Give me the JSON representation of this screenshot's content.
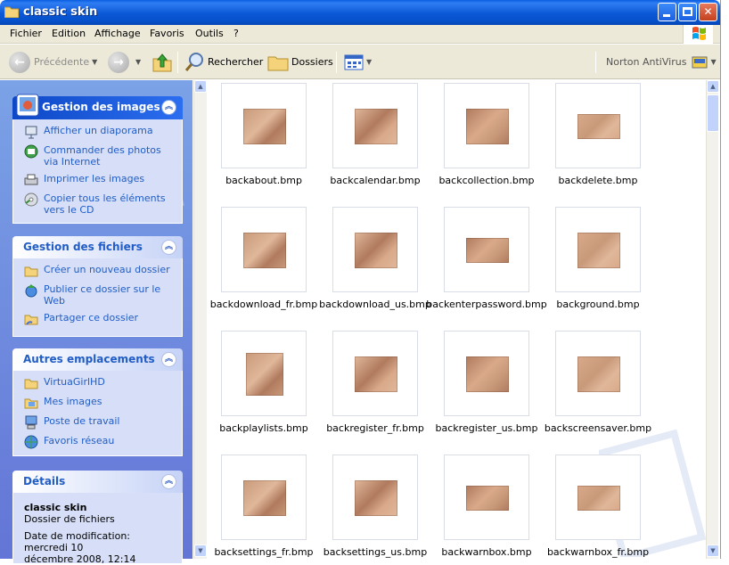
{
  "window": {
    "title": "classic skin",
    "icon": "folder-icon"
  },
  "menu": [
    "Fichier",
    "Edition",
    "Affichage",
    "Favoris",
    "Outils",
    "?"
  ],
  "toolbar": {
    "back_label": "Précédente",
    "search_label": "Rechercher",
    "folders_label": "Dossiers",
    "antivirus_label": "Norton AntiVirus"
  },
  "taskpane": {
    "images_panel": {
      "title": "Gestion des images",
      "items": [
        {
          "label": "Afficher un diaporama",
          "icon": "slideshow-icon"
        },
        {
          "label": "Commander des photos via Internet",
          "icon": "order-photos-icon"
        },
        {
          "label": "Imprimer les images",
          "icon": "printer-icon"
        },
        {
          "label": "Copier tous les éléments vers le CD",
          "icon": "cd-icon"
        }
      ]
    },
    "files_panel": {
      "title": "Gestion des fichiers",
      "items": [
        {
          "label": "Créer un nouveau dossier",
          "icon": "new-folder-icon"
        },
        {
          "label": "Publier ce dossier sur le Web",
          "icon": "publish-web-icon"
        },
        {
          "label": "Partager ce dossier",
          "icon": "share-folder-icon"
        }
      ]
    },
    "places_panel": {
      "title": "Autres emplacements",
      "items": [
        {
          "label": "VirtuaGirlHD",
          "icon": "folder-icon"
        },
        {
          "label": "Mes images",
          "icon": "my-pictures-icon"
        },
        {
          "label": "Poste de travail",
          "icon": "my-computer-icon"
        },
        {
          "label": "Favoris réseau",
          "icon": "network-icon"
        }
      ]
    },
    "details_panel": {
      "title": "Détails",
      "name": "classic skin",
      "type": "Dossier de fichiers",
      "modified_line1": "Date de modification: mercredi 10",
      "modified_line2": "décembre 2008, 12:14"
    }
  },
  "files": [
    "backabout.bmp",
    "backcalendar.bmp",
    "backcollection.bmp",
    "backdelete.bmp",
    "backdownload_fr.bmp",
    "backdownload_us.bmp",
    "backenterpassword.bmp",
    "background.bmp",
    "backplaylists.bmp",
    "backregister_fr.bmp",
    "backregister_us.bmp",
    "backscreensaver.bmp",
    "backsettings_fr.bmp",
    "backsettings_us.bmp",
    "backwarnbox.bmp",
    "backwarnbox_fr.bmp"
  ],
  "colors": {
    "titlebar": "#0a5ee0",
    "taskpane_bg": "#6f8fe0",
    "link": "#215dc6",
    "thumb_palette": [
      "#c89a7a",
      "#e0b79a",
      "#b07a5e",
      "#d9a98a"
    ]
  }
}
